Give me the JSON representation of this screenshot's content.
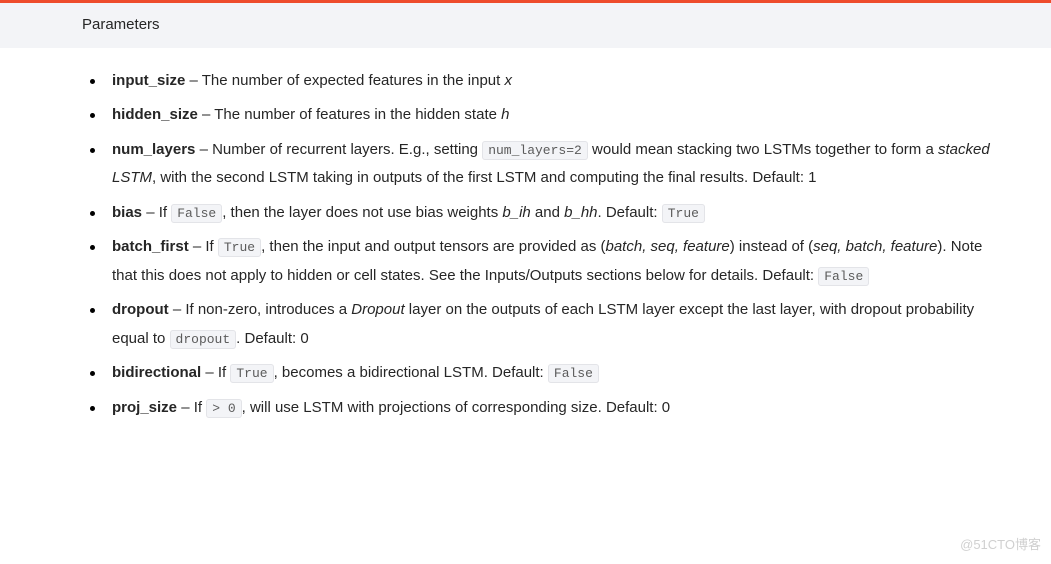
{
  "header": {
    "title": "Parameters"
  },
  "params": {
    "input_size": {
      "name": "input_size",
      "desc_a": "– The number of expected features in the input ",
      "var": "x"
    },
    "hidden_size": {
      "name": "hidden_size",
      "desc_a": "– The number of features in the hidden state ",
      "var": "h"
    },
    "num_layers": {
      "name": "num_layers",
      "desc_a": "– Number of recurrent layers. E.g., setting ",
      "code_a": "num_layers=2",
      "desc_b": " would mean stacking two LSTMs together to form a ",
      "em_a": "stacked LSTM",
      "desc_c": ", with the second LSTM taking in outputs of the first LSTM and computing the final results. Default: 1"
    },
    "bias": {
      "name": "bias",
      "desc_a": "– If ",
      "code_a": "False",
      "desc_b": ", then the layer does not use bias weights ",
      "em_a": "b_ih",
      "desc_c": " and ",
      "em_b": "b_hh",
      "desc_d": ". Default: ",
      "code_b": "True"
    },
    "batch_first": {
      "name": "batch_first",
      "desc_a": "– If ",
      "code_a": "True",
      "desc_b": ", then the input and output tensors are provided as (",
      "em_a": "batch, seq, feature",
      "desc_c": ") instead of (",
      "em_b": "seq, batch, feature",
      "desc_d": "). Note that this does not apply to hidden or cell states. See the Inputs/Outputs sections below for details. Default: ",
      "code_b": "False"
    },
    "dropout": {
      "name": "dropout",
      "desc_a": "– If non-zero, introduces a ",
      "em_a": "Dropout",
      "desc_b": " layer on the outputs of each LSTM layer except the last layer, with dropout probability equal to ",
      "code_a": "dropout",
      "desc_c": ". Default: 0"
    },
    "bidirectional": {
      "name": "bidirectional",
      "desc_a": "– If ",
      "code_a": "True",
      "desc_b": ", becomes a bidirectional LSTM. Default: ",
      "code_b": "False"
    },
    "proj_size": {
      "name": "proj_size",
      "desc_a": "– If ",
      "code_a": "> 0",
      "desc_b": ", will use LSTM with projections of corresponding size. Default: 0"
    }
  },
  "watermark": "@51CTO博客"
}
